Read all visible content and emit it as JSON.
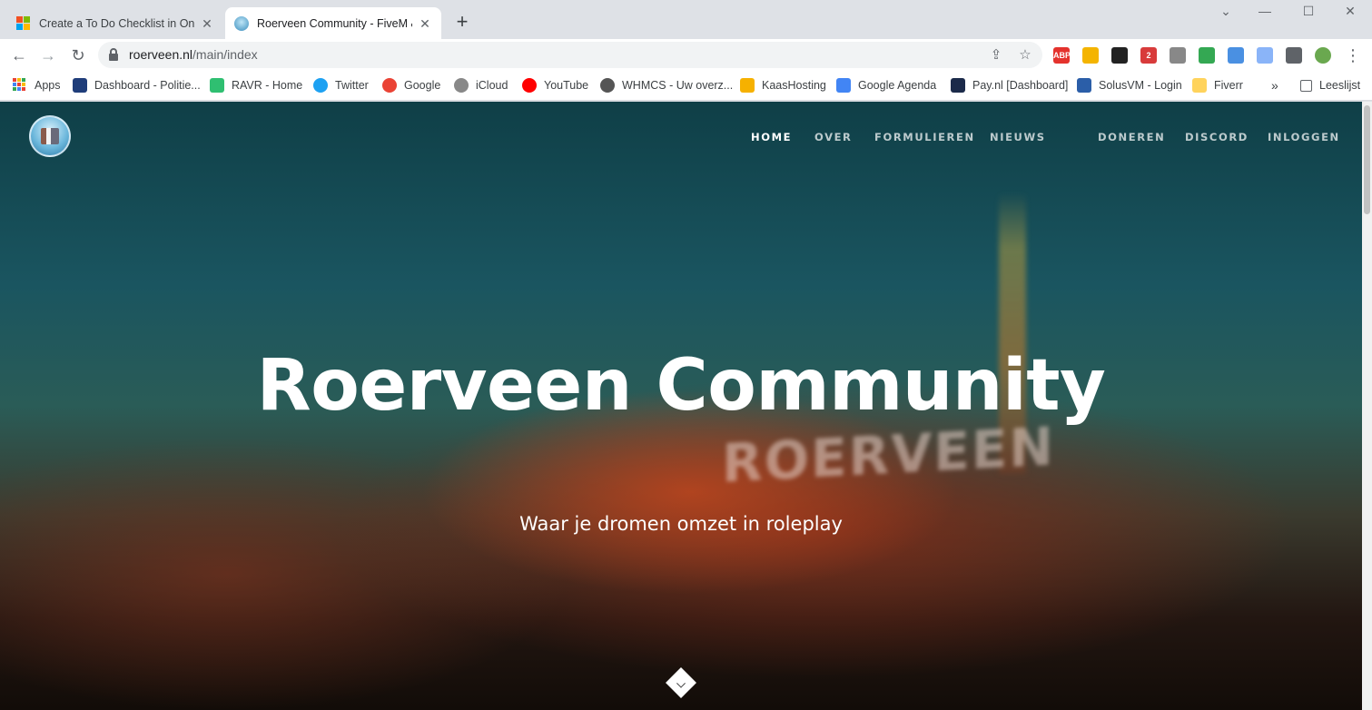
{
  "tabs": [
    {
      "title": "Create a To Do Checklist in OneN",
      "close": "✕"
    },
    {
      "title": "Roerveen Community - FiveM &",
      "close": "✕"
    }
  ],
  "new_tab": "+",
  "window_controls": {
    "minimize": "⌄",
    "restore": "—",
    "maximize": "☐",
    "close": "✕"
  },
  "address_bar": {
    "host": "roerveen.nl",
    "path": "/main/index"
  },
  "toolbar_icons": {
    "back": "←",
    "forward": "→",
    "reload": "↻",
    "share": "⇪",
    "star": "☆",
    "menu": "⋮"
  },
  "extensions": [
    {
      "name": "abp-icon",
      "label": "ABP",
      "color": "#e4322d"
    },
    {
      "name": "stack-icon",
      "label": "",
      "color": "#f4b400"
    },
    {
      "name": "tampermonkey-icon",
      "label": "",
      "color": "#222222"
    },
    {
      "name": "dots-icon",
      "label": "2",
      "color": "#d83b3b"
    },
    {
      "name": "gear-ext-icon",
      "label": "",
      "color": "#888888"
    },
    {
      "name": "color-wheel-icon",
      "label": "",
      "color": "#34a853"
    },
    {
      "name": "chart-ext-icon",
      "label": "",
      "color": "#4a90e2"
    },
    {
      "name": "search-ext-icon",
      "label": "",
      "color": "#8ab4f8"
    },
    {
      "name": "puzzle-icon",
      "label": "",
      "color": "#5f6368"
    },
    {
      "name": "profile-icon",
      "label": "",
      "color": "#6aa84f"
    }
  ],
  "bookmarks": [
    {
      "label": "Apps",
      "color": "#4285f4"
    },
    {
      "label": "Dashboard - Politie...",
      "color": "#1f3d7a"
    },
    {
      "label": "RAVR - Home",
      "color": "#2fbf71"
    },
    {
      "label": "Twitter",
      "color": "#1da1f2"
    },
    {
      "label": "Google",
      "color": "#ea4335"
    },
    {
      "label": "iCloud",
      "color": "#888888"
    },
    {
      "label": "YouTube",
      "color": "#ff0000"
    },
    {
      "label": "WHMCS - Uw overz...",
      "color": "#555555"
    },
    {
      "label": "KaasHosting",
      "color": "#f6b100"
    },
    {
      "label": "Google Agenda",
      "color": "#4285f4"
    },
    {
      "label": "Pay.nl [Dashboard]",
      "color": "#1b2a4a"
    },
    {
      "label": "SolusVM - Login",
      "color": "#2b5ea8"
    },
    {
      "label": "Fiverr",
      "color": "#ffd35c"
    }
  ],
  "bookmarks_more": "»",
  "reading_list": "Leeslijst",
  "site": {
    "nav": [
      "HOME",
      "OVER",
      "FORMULIEREN",
      "NIEUWS",
      "DONEREN",
      "DISCORD",
      "INLOGGEN"
    ],
    "sign_text": "ROERVEEN",
    "hero_title": "Roerveen Community",
    "hero_subtitle": "Waar je dromen omzet in roleplay"
  }
}
